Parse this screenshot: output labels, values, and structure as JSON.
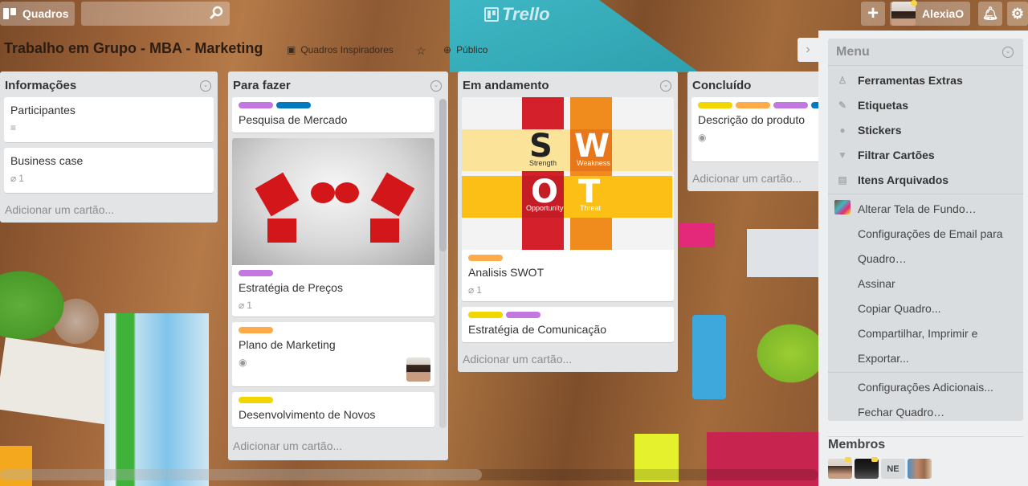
{
  "header": {
    "boards_label": "Quadros",
    "search_placeholder": "",
    "logo_text": "Trello",
    "username": "AlexiaO"
  },
  "board": {
    "title": "Trabalho em Grupo - MBA - Marketing",
    "team": "Quadros Inspiradores",
    "visibility": "Público"
  },
  "colors": {
    "purple": "#c377e0",
    "blue": "#0079bf",
    "orange": "#ffab4a",
    "yellow": "#f2d600"
  },
  "lists": [
    {
      "title": "Informações",
      "cards": [
        {
          "title": "Participantes",
          "has_description": true
        },
        {
          "title": "Business case",
          "attachments": "1"
        }
      ],
      "add_card": "Adicionar um cartão..."
    },
    {
      "title": "Para fazer",
      "cards": [
        {
          "title": "Pesquisa de Mercado",
          "labels": [
            "purple",
            "blue"
          ]
        },
        {
          "title": "Estratégia de Preços",
          "labels": [
            "purple"
          ],
          "attachments": "1",
          "cover": "boxing-price-tags"
        },
        {
          "title": "Plano de Marketing",
          "labels": [
            "orange"
          ],
          "watching": true,
          "member": "AlexiaO"
        },
        {
          "title": "Desenvolvimento de Novos",
          "labels": [
            "yellow"
          ]
        }
      ],
      "add_card": "Adicionar um cartão..."
    },
    {
      "title": "Em andamento",
      "cards": [
        {
          "title": "Analisis SWOT",
          "labels": [
            "orange"
          ],
          "attachments": "1",
          "cover": "swot",
          "cover_text": {
            "s": "S",
            "s_sub": "Strength",
            "w": "W",
            "w_sub": "Weakness",
            "o": "O",
            "o_sub": "Opportunity",
            "t": "T",
            "t_sub": "Threat"
          }
        },
        {
          "title": "Estratégia de Comunicação",
          "labels": [
            "yellow",
            "purple"
          ]
        }
      ],
      "add_card": "Adicionar um cartão..."
    },
    {
      "title": "Concluído",
      "cards": [
        {
          "title": "Descrição do produto",
          "labels": [
            "yellow",
            "orange",
            "purple",
            "blue"
          ],
          "watching": true
        }
      ],
      "add_card": "Adicionar um cartão..."
    }
  ],
  "sidebar": {
    "menu_title": "Menu",
    "primary_items": [
      {
        "label": "Ferramentas Extras",
        "icon": "power-ups-icon"
      },
      {
        "label": "Etiquetas",
        "icon": "label-icon"
      },
      {
        "label": "Stickers",
        "icon": "sticker-icon"
      },
      {
        "label": "Filtrar Cartões",
        "icon": "filter-icon"
      },
      {
        "label": "Itens Arquivados",
        "icon": "archive-icon"
      }
    ],
    "secondary_items": [
      {
        "label": "Alterar Tela de Fundo…"
      },
      {
        "label": "Configurações de Email para"
      },
      {
        "label": "Quadro…"
      },
      {
        "label": "Assinar"
      },
      {
        "label": "Copiar Quadro..."
      },
      {
        "label": "Compartilhar, Imprimir e"
      },
      {
        "label": "Exportar..."
      }
    ],
    "tertiary_items": [
      {
        "label": "Configurações Adicionais..."
      },
      {
        "label": "Fechar Quadro…"
      }
    ],
    "members_title": "Membros",
    "members": [
      {
        "initials": "",
        "admin": true
      },
      {
        "initials": "",
        "admin": true
      },
      {
        "initials": "NE",
        "admin": false
      },
      {
        "initials": "",
        "admin": false
      }
    ]
  }
}
